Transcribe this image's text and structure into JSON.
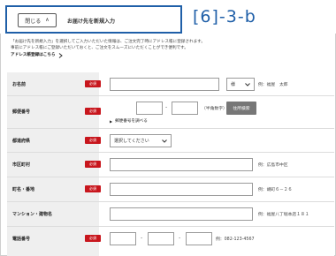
{
  "header": {
    "close_label": "閉じる",
    "close_chevron": "∧",
    "title": "お届け先を新規入力",
    "step": "[6]-3-b"
  },
  "intro": {
    "line1": "「お届け先を新規入力」を選択してご入力いただいた情報は、ご注文完了時にアドレス帳に登録されます。",
    "line2": "事前にアドレス帳にご登録いただいておくと、ご注文をスムーズにいただくことができ便利です。",
    "link": "アドレス帳登録はこちら",
    "link_icon": "chevron-right-icon"
  },
  "form": {
    "required_label": "必須",
    "name": {
      "label": "お名前",
      "honorific": "様",
      "example": "例：福屋　太郎"
    },
    "zip": {
      "label": "郵便番号",
      "note": "（半角数字）",
      "search_button": "住所検索",
      "lookup_link": "郵便番号を調べる",
      "dash": "-"
    },
    "pref": {
      "label": "都道府県",
      "placeholder": "選択してください"
    },
    "city": {
      "label": "市区町村",
      "example": "例：広島市中区"
    },
    "street": {
      "label": "町名・番地",
      "example": "例：胡町６－２６"
    },
    "building": {
      "label": "マンション・建物名",
      "example": "例：福屋八丁堀本店１８１"
    },
    "phone": {
      "label": "電話番号",
      "dash": "-",
      "example": "例：082-123-4567"
    }
  }
}
